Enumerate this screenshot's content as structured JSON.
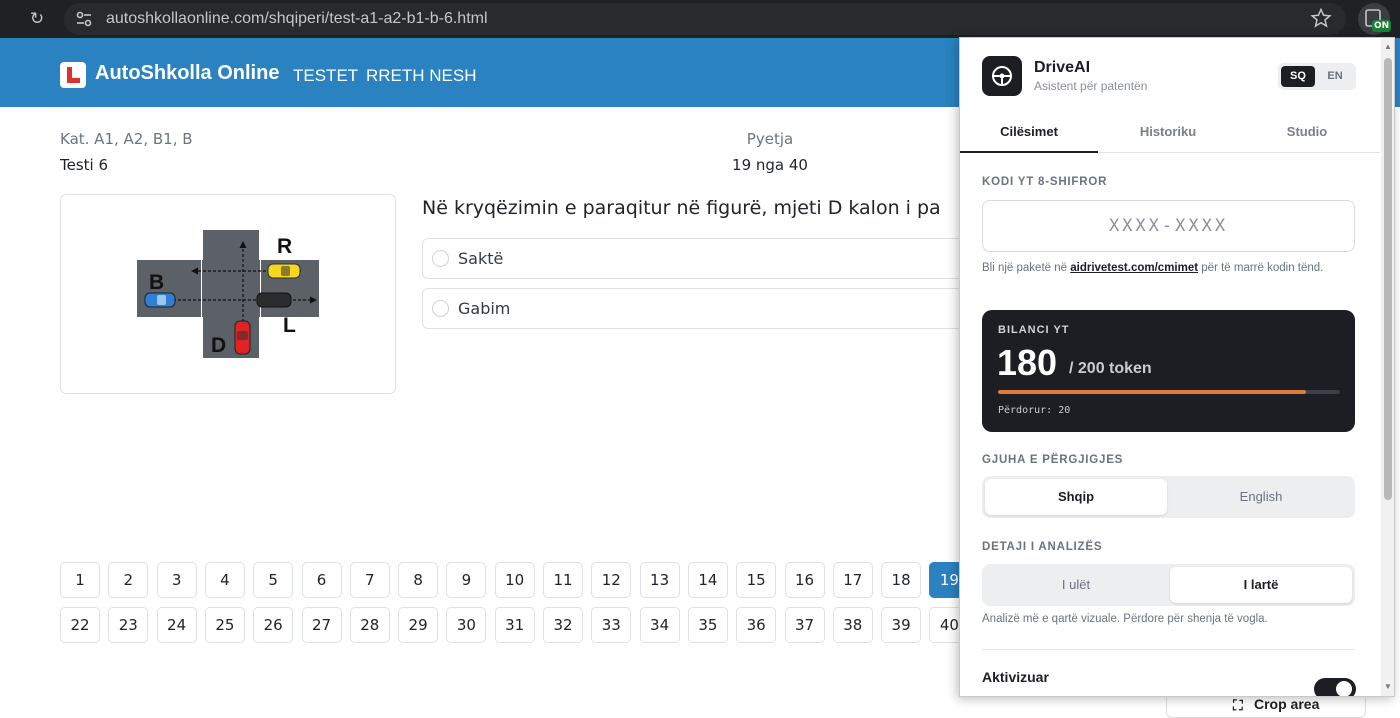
{
  "browser": {
    "url": "autoshkollaonline.com/shqiperi/test-a1-a2-b1-b-6.html",
    "extension_badge": "ON"
  },
  "site": {
    "brand": "AutoShkolla Online",
    "nav": [
      "TESTET",
      "RRETH NESH"
    ]
  },
  "test": {
    "category": "Kat. A1, A2, B1, B",
    "name": "Testi 6",
    "question_label": "Pyetja",
    "question_progress": "19 nga 40",
    "question_text": "Në kryqëzimin e paraqitur në figurë, mjeti D kalon i pa",
    "answers": [
      "Saktë",
      "Gabim"
    ],
    "figure_labels": {
      "r": "R",
      "b": "B",
      "d": "D",
      "l": "L"
    }
  },
  "pagination": {
    "row1": [
      "1",
      "2",
      "3",
      "4",
      "5",
      "6",
      "7",
      "8",
      "9",
      "10",
      "11",
      "12",
      "13",
      "14",
      "15",
      "16",
      "17",
      "18",
      "19"
    ],
    "row2": [
      "22",
      "23",
      "24",
      "25",
      "26",
      "27",
      "28",
      "29",
      "30",
      "31",
      "32",
      "33",
      "34",
      "35",
      "36",
      "37",
      "38",
      "39",
      "40"
    ],
    "active": "19"
  },
  "crop_button": "Crop area",
  "panel": {
    "title": "DriveAI",
    "subtitle": "Asistent për patentën",
    "lang_sq": "SQ",
    "lang_en": "EN",
    "tabs": [
      "Cilësimet",
      "Historiku",
      "Studio"
    ],
    "code_label": "KODI YT 8-SHIFROR",
    "code_placeholder": "XXXX-XXXX",
    "buy_note_before": "Bli një paketë në ",
    "buy_note_link": "aidrivetest.com/cmimet",
    "buy_note_after": " për të marrë kodin tënd.",
    "balance_label": "BILANCI YT",
    "balance_value": "180",
    "balance_total": "/ 200 token",
    "balance_fraction": 0.9,
    "balance_used": "Përdorur: 20",
    "response_lang_label": "GJUHA E PËRGJIGJES",
    "response_lang_options": [
      "Shqip",
      "English"
    ],
    "detail_label": "DETAJI I ANALIZËS",
    "detail_options": [
      "I ulët",
      "I lartë"
    ],
    "detail_note": "Analizë më e qartë vizuale. Përdore për shenja të vogla.",
    "enabled_label": "Aktivizuar"
  },
  "colors": {
    "site_primary": "#2b82c0",
    "panel_dark": "#1c1e24",
    "progress_fill": "#e07a3a"
  }
}
